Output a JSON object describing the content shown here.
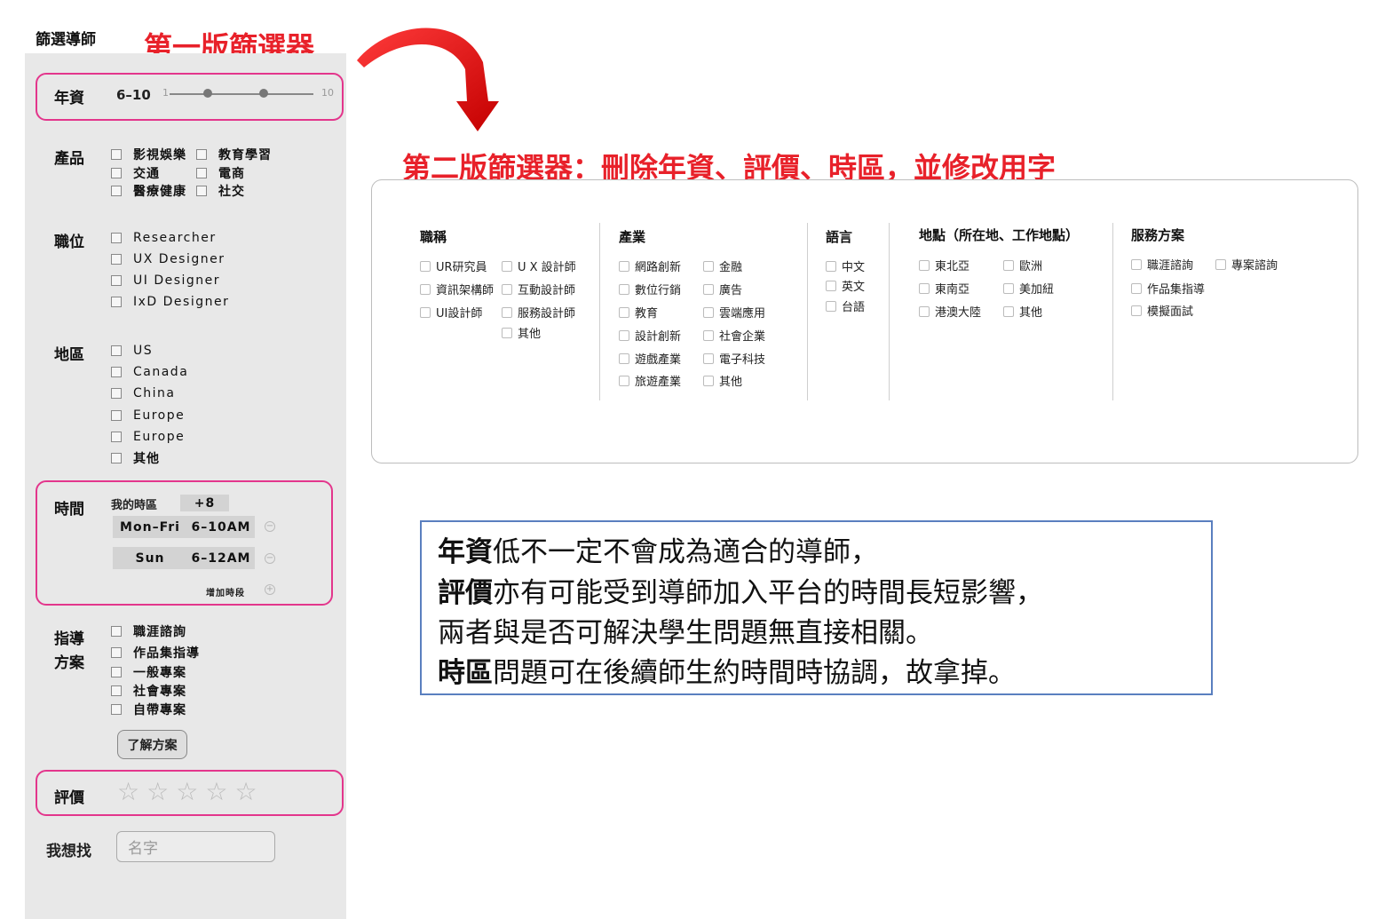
{
  "left_panel": {
    "title": "篩選導師",
    "version_heading": "第一版篩選器",
    "seniority": {
      "label": "年資",
      "value": "6–10",
      "min": "1",
      "max": "10"
    },
    "product": {
      "label": "產品",
      "options": [
        "影視娛樂",
        "教育學習",
        "交通",
        "電商",
        "醫療健康",
        "社交"
      ]
    },
    "position": {
      "label": "職位",
      "options": [
        "Researcher",
        "UX Designer",
        "UI Designer",
        "IxD Designer"
      ]
    },
    "region": {
      "label": "地區",
      "options": [
        "US",
        "Canada",
        "China",
        "Europe",
        "Europe",
        "其他"
      ]
    },
    "time": {
      "label": "時間",
      "my_tz_label": "我的時區",
      "my_tz_value": "+8",
      "slots": [
        {
          "day": "Mon–Fri",
          "range": "6–10AM"
        },
        {
          "day": "Sun",
          "range": "6–12AM"
        }
      ],
      "add_slot": "增加時段"
    },
    "plan": {
      "label_line1": "指導",
      "label_line2": "方案",
      "options": [
        "職涯諮詢",
        "作品集指導",
        "一般專案",
        "社會專案",
        "自帶專案"
      ],
      "button": "了解方案"
    },
    "rating": {
      "label": "評價",
      "stars": 5,
      "filled": 0
    },
    "search": {
      "label": "我想找",
      "placeholder": "名字"
    }
  },
  "v2": {
    "heading": "第二版篩選器：刪除年資、評價、時區，並修改用字",
    "columns": {
      "title": {
        "label": "職稱",
        "a": [
          "UR研究員",
          "資訊架構師",
          "UI設計師"
        ],
        "b": [
          "U X 設計師",
          "互動設計師",
          "服務設計師",
          "其他"
        ]
      },
      "industry": {
        "label": "產業",
        "a": [
          "網路創新",
          "數位行銷",
          "教育",
          "設計創新",
          "遊戲產業",
          "旅遊產業"
        ],
        "b": [
          "金融",
          "廣告",
          "雲端應用",
          "社會企業",
          "電子科技",
          "其他"
        ]
      },
      "language": {
        "label": "語言",
        "a": [
          "中文",
          "英文",
          "台語"
        ]
      },
      "location": {
        "label": "地點（所在地、工作地點）",
        "a": [
          "東北亞",
          "東南亞",
          "港澳大陸"
        ],
        "b": [
          "歐洲",
          "美加紐",
          "其他"
        ]
      },
      "service": {
        "label": "服務方案",
        "a": [
          "職涯諮詢",
          "作品集指導",
          "模擬面試"
        ],
        "b": [
          "專案諮詢"
        ]
      }
    }
  },
  "note": {
    "line1_bold": "年資",
    "line1_rest": "低不一定不會成為適合的導師，",
    "line2_bold": "評價",
    "line2_rest": "亦有可能受到導師加入平台的時間長短影響，",
    "line3": "兩者與是否可解決學生問題無直接相關。",
    "line4_bold": "時區",
    "line4_rest": "問題可在後續師生約時間時協調，故拿掉。"
  },
  "colors": {
    "accent_red": "#e8212a",
    "highlight_pink": "#e3368c",
    "note_border": "#5a7fbf",
    "panel_bg": "#e8e8e8"
  }
}
